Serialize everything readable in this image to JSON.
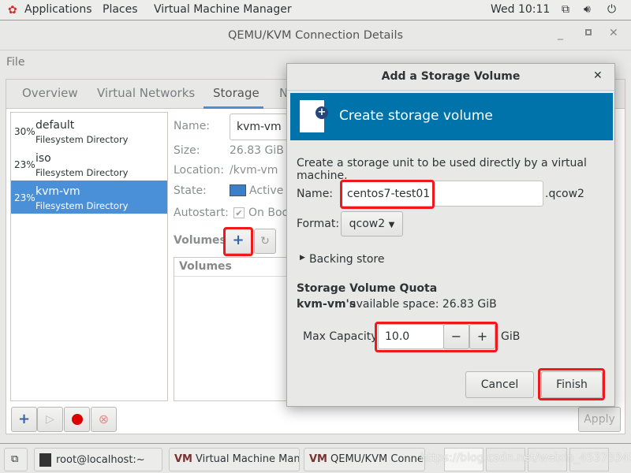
{
  "topbar": {
    "applications": "Applications",
    "places": "Places",
    "app": "Virtual Machine Manager",
    "clock": "Wed 10:11",
    "icons": [
      "network-icon",
      "volume-icon",
      "power-icon"
    ]
  },
  "window": {
    "title": "QEMU/KVM Connection Details",
    "menu": "File"
  },
  "tabs": [
    "Overview",
    "Virtual Networks",
    "Storage",
    "N"
  ],
  "pools": [
    {
      "pct": "30%",
      "name": "default",
      "type": "Filesystem Directory"
    },
    {
      "pct": "23%",
      "name": "iso",
      "type": "Filesystem Directory"
    },
    {
      "pct": "23%",
      "name": "kvm-vm",
      "type": "Filesystem Directory",
      "selected": true
    }
  ],
  "details": {
    "name_label": "Name:",
    "name_value": "kvm-vm",
    "size_label": "Size:",
    "size_value": "26.83 GiB F",
    "location_label": "Location:",
    "location_value": "/kvm-vm",
    "state_label": "State:",
    "state_value": "Active",
    "autostart_label": "Autostart:",
    "autostart_value": "On Boo",
    "volumes_label": "Volumes",
    "volumes_header": "Volumes",
    "apply": "Apply"
  },
  "dialog": {
    "title": "Add a Storage Volume",
    "banner": "Create storage volume",
    "description": "Create a storage unit to be used directly by a virtual machine.",
    "name_label": "Name:",
    "name_value": "centos7-test01",
    "name_suffix": ".qcow2",
    "format_label": "Format:",
    "format_value": "qcow2",
    "backing_store": "Backing store",
    "quota_title": "Storage Volume Quota",
    "pool_name": "kvm-vm's",
    "available": "available space: 26.83 GiB",
    "capacity_label": "Max Capacity:",
    "capacity_value": "10.0",
    "capacity_unit": "GiB",
    "cancel": "Cancel",
    "finish": "Finish"
  },
  "taskbar": {
    "items": [
      "root@localhost:~",
      "Virtual Machine Man...",
      "QEMU/KVM Conne..."
    ],
    "watermark": "https://blog.csdn.net/weixin_45373345"
  },
  "colors": {
    "accent": "#4a90d9",
    "banner": "#0073aa",
    "highlight": "#f0181c"
  }
}
